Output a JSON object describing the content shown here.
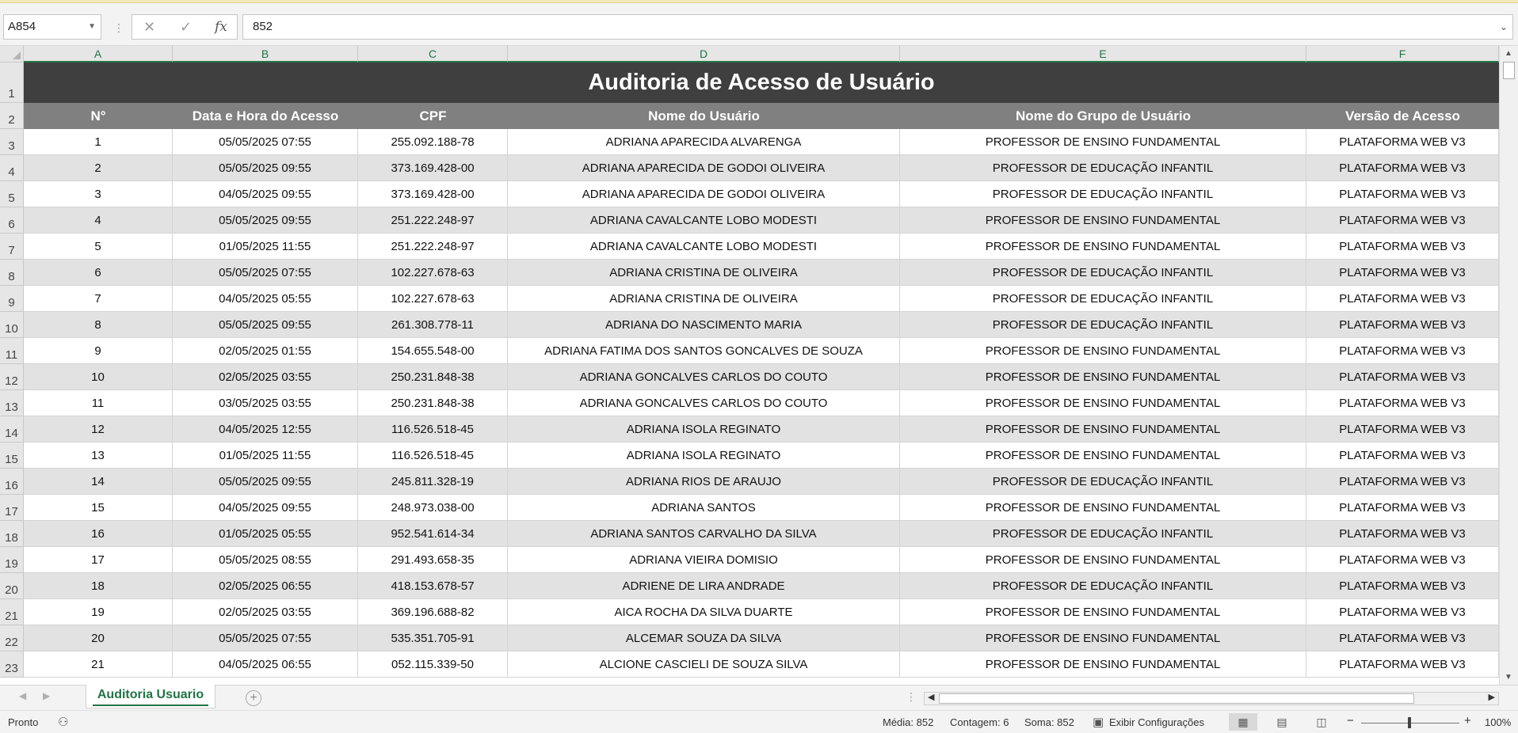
{
  "formula_bar": {
    "name_box": "A854",
    "cancel_icon": "✕",
    "enter_icon": "✓",
    "fx_label": "fx",
    "value": "852"
  },
  "columns": [
    "A",
    "B",
    "C",
    "D",
    "E",
    "F"
  ],
  "sheet": {
    "title": "Auditoria de Acesso de Usuário",
    "headers": [
      "N°",
      "Data e Hora do Acesso",
      "CPF",
      "Nome do Usuário",
      "Nome do Grupo de Usuário",
      "Versão de Acesso"
    ],
    "rows": [
      [
        "1",
        "05/05/2025 07:55",
        "255.092.188-78",
        "ADRIANA APARECIDA ALVARENGA",
        "PROFESSOR DE ENSINO FUNDAMENTAL",
        "PLATAFORMA WEB V3"
      ],
      [
        "2",
        "05/05/2025 09:55",
        "373.169.428-00",
        "ADRIANA APARECIDA DE GODOI OLIVEIRA",
        "PROFESSOR DE EDUCAÇÃO INFANTIL",
        "PLATAFORMA WEB V3"
      ],
      [
        "3",
        "04/05/2025 09:55",
        "373.169.428-00",
        "ADRIANA APARECIDA DE GODOI OLIVEIRA",
        "PROFESSOR DE EDUCAÇÃO INFANTIL",
        "PLATAFORMA WEB V3"
      ],
      [
        "4",
        "05/05/2025 09:55",
        "251.222.248-97",
        "ADRIANA CAVALCANTE LOBO MODESTI",
        "PROFESSOR DE ENSINO FUNDAMENTAL",
        "PLATAFORMA WEB V3"
      ],
      [
        "5",
        "01/05/2025 11:55",
        "251.222.248-97",
        "ADRIANA CAVALCANTE LOBO MODESTI",
        "PROFESSOR DE ENSINO FUNDAMENTAL",
        "PLATAFORMA WEB V3"
      ],
      [
        "6",
        "05/05/2025 07:55",
        "102.227.678-63",
        "ADRIANA CRISTINA DE OLIVEIRA",
        "PROFESSOR DE EDUCAÇÃO INFANTIL",
        "PLATAFORMA WEB V3"
      ],
      [
        "7",
        "04/05/2025 05:55",
        "102.227.678-63",
        "ADRIANA CRISTINA DE OLIVEIRA",
        "PROFESSOR DE EDUCAÇÃO INFANTIL",
        "PLATAFORMA WEB V3"
      ],
      [
        "8",
        "05/05/2025 09:55",
        "261.308.778-11",
        "ADRIANA DO NASCIMENTO MARIA",
        "PROFESSOR DE EDUCAÇÃO INFANTIL",
        "PLATAFORMA WEB V3"
      ],
      [
        "9",
        "02/05/2025 01:55",
        "154.655.548-00",
        "ADRIANA FATIMA DOS SANTOS GONCALVES DE SOUZA",
        "PROFESSOR DE ENSINO FUNDAMENTAL",
        "PLATAFORMA WEB V3"
      ],
      [
        "10",
        "02/05/2025 03:55",
        "250.231.848-38",
        "ADRIANA GONCALVES CARLOS DO COUTO",
        "PROFESSOR DE ENSINO FUNDAMENTAL",
        "PLATAFORMA WEB V3"
      ],
      [
        "11",
        "03/05/2025 03:55",
        "250.231.848-38",
        "ADRIANA GONCALVES CARLOS DO COUTO",
        "PROFESSOR DE ENSINO FUNDAMENTAL",
        "PLATAFORMA WEB V3"
      ],
      [
        "12",
        "04/05/2025 12:55",
        "116.526.518-45",
        "ADRIANA ISOLA REGINATO",
        "PROFESSOR DE ENSINO FUNDAMENTAL",
        "PLATAFORMA WEB V3"
      ],
      [
        "13",
        "01/05/2025 11:55",
        "116.526.518-45",
        "ADRIANA ISOLA REGINATO",
        "PROFESSOR DE ENSINO FUNDAMENTAL",
        "PLATAFORMA WEB V3"
      ],
      [
        "14",
        "05/05/2025 09:55",
        "245.811.328-19",
        "ADRIANA RIOS DE ARAUJO",
        "PROFESSOR DE EDUCAÇÃO INFANTIL",
        "PLATAFORMA WEB V3"
      ],
      [
        "15",
        "04/05/2025 09:55",
        "248.973.038-00",
        "ADRIANA SANTOS",
        "PROFESSOR DE ENSINO FUNDAMENTAL",
        "PLATAFORMA WEB V3"
      ],
      [
        "16",
        "01/05/2025 05:55",
        "952.541.614-34",
        "ADRIANA SANTOS CARVALHO DA SILVA",
        "PROFESSOR DE EDUCAÇÃO INFANTIL",
        "PLATAFORMA WEB V3"
      ],
      [
        "17",
        "05/05/2025 08:55",
        "291.493.658-35",
        "ADRIANA VIEIRA DOMISIO",
        "PROFESSOR DE ENSINO FUNDAMENTAL",
        "PLATAFORMA WEB V3"
      ],
      [
        "18",
        "02/05/2025 06:55",
        "418.153.678-57",
        "ADRIENE DE LIRA ANDRADE",
        "PROFESSOR DE EDUCAÇÃO INFANTIL",
        "PLATAFORMA WEB V3"
      ],
      [
        "19",
        "02/05/2025 03:55",
        "369.196.688-82",
        "AICA ROCHA DA SILVA DUARTE",
        "PROFESSOR DE ENSINO FUNDAMENTAL",
        "PLATAFORMA WEB V3"
      ],
      [
        "20",
        "05/05/2025 07:55",
        "535.351.705-91",
        "ALCEMAR SOUZA DA SILVA",
        "PROFESSOR DE ENSINO FUNDAMENTAL",
        "PLATAFORMA WEB V3"
      ],
      [
        "21",
        "04/05/2025 06:55",
        "052.115.339-50",
        "ALCIONE CASCIELI DE SOUZA SILVA",
        "PROFESSOR DE ENSINO FUNDAMENTAL",
        "PLATAFORMA WEB V3"
      ]
    ]
  },
  "row_numbers": [
    "1",
    "2",
    "3",
    "4",
    "5",
    "6",
    "7",
    "8",
    "9",
    "10",
    "11",
    "12",
    "13",
    "14",
    "15",
    "16",
    "17",
    "18",
    "19",
    "20",
    "21",
    "22",
    "23"
  ],
  "tabs": {
    "active": "Auditoria Usuario",
    "add_icon": "+"
  },
  "status_bar": {
    "ready": "Pronto",
    "average": "Média: 852",
    "count": "Contagem: 6",
    "sum": "Soma: 852",
    "display_settings": "Exibir Configurações",
    "zoom_minus": "−",
    "zoom_plus": "+",
    "zoom": "100%"
  },
  "colors": {
    "accent": "#217346",
    "title_bg": "#3f3f3f",
    "header_bg": "#808080",
    "band": "#e2e2e2"
  }
}
